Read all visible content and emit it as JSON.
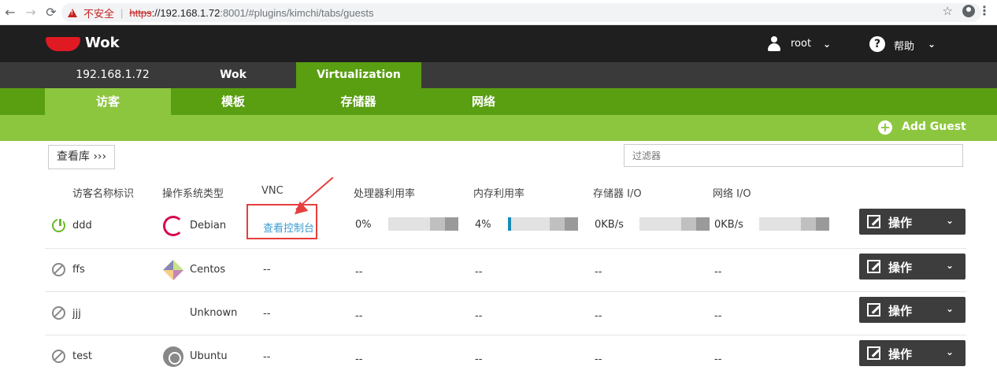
{
  "browser": {
    "insecure_label": "不安全",
    "url_scheme": "https",
    "url_host": "://192.168.1.72",
    "url_rest": ":8001/#plugins/kimchi/tabs/guests"
  },
  "header": {
    "brand": "Wok",
    "user": "root",
    "help": "帮助"
  },
  "tabs_top": [
    "192.168.1.72",
    "Wok",
    "Virtualization"
  ],
  "tabs_sub": [
    "访客",
    "模板",
    "存储器",
    "网络"
  ],
  "actions": {
    "add_guest": "Add Guest"
  },
  "toolbar": {
    "view_gallery": "查看库 ›››",
    "filter_placeholder": "过滤器"
  },
  "columns": [
    "访客名称标识",
    "操作系统类型",
    "VNC",
    "处理器利用率",
    "内存利用率",
    "存储器 I/O",
    "网络 I/O"
  ],
  "guests": [
    {
      "state": "running",
      "name": "ddd",
      "os": "Debian",
      "os_icon": "debian-icon",
      "vnc": "查看控制台",
      "cpu": "0%",
      "cpu_value": 0,
      "mem": "4%",
      "mem_value": 0.04,
      "storage": "0KB/s",
      "network": "0KB/s",
      "action": "操作"
    },
    {
      "state": "stopped",
      "name": "ffs",
      "os": "Centos",
      "os_icon": "centos-icon",
      "vnc": "--",
      "cpu": "--",
      "mem": "--",
      "storage": "--",
      "network": "--",
      "action": "操作"
    },
    {
      "state": "stopped",
      "name": "jjj",
      "os": "Unknown",
      "os_icon": "",
      "vnc": "--",
      "cpu": "--",
      "mem": "--",
      "storage": "--",
      "network": "--",
      "action": "操作"
    },
    {
      "state": "stopped",
      "name": "test",
      "os": "Ubuntu",
      "os_icon": "ubuntu-icon",
      "vnc": "--",
      "cpu": "--",
      "mem": "--",
      "storage": "--",
      "network": "--",
      "action": "操作"
    }
  ],
  "colors": {
    "header_bg": "#1f1f1f",
    "tab_active": "#5a9e11",
    "subtab_active": "#8cc63f",
    "link": "#3b9ccf",
    "annotation": "#e63e3e"
  }
}
